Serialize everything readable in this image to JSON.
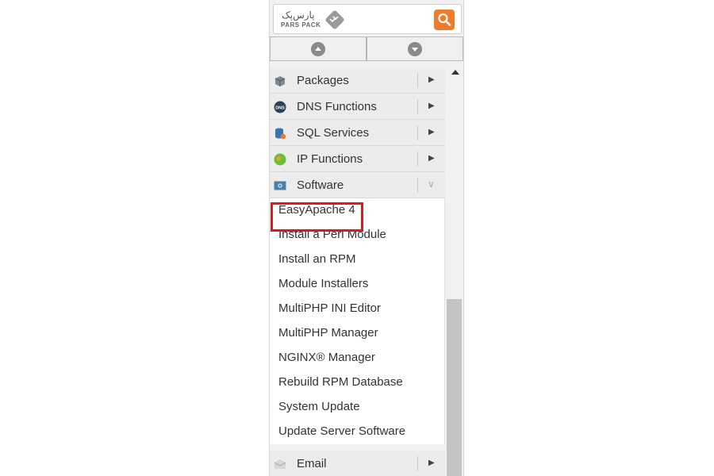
{
  "logo": {
    "text_fa": "پارس‌پک",
    "text_en": "PARS PACK"
  },
  "menu": {
    "categories": [
      {
        "label": "Packages",
        "icon": "package-icon"
      },
      {
        "label": "DNS Functions",
        "icon": "dns-icon"
      },
      {
        "label": "SQL Services",
        "icon": "database-icon"
      },
      {
        "label": "IP Functions",
        "icon": "globe-icon"
      },
      {
        "label": "Software",
        "icon": "software-icon",
        "expanded": true
      }
    ],
    "software_items": [
      "EasyApache 4",
      "Install a Perl Module",
      "Install an RPM",
      "Module Installers",
      "MultiPHP INI Editor",
      "MultiPHP Manager",
      "NGINX® Manager",
      "Rebuild RPM Database",
      "System Update",
      "Update Server Software"
    ],
    "email": {
      "label": "Email",
      "icon": "email-icon"
    }
  },
  "highlighted_item": "EasyApache 4",
  "colors": {
    "search_button": "#ef7b2a",
    "highlight": "#e0171f"
  }
}
